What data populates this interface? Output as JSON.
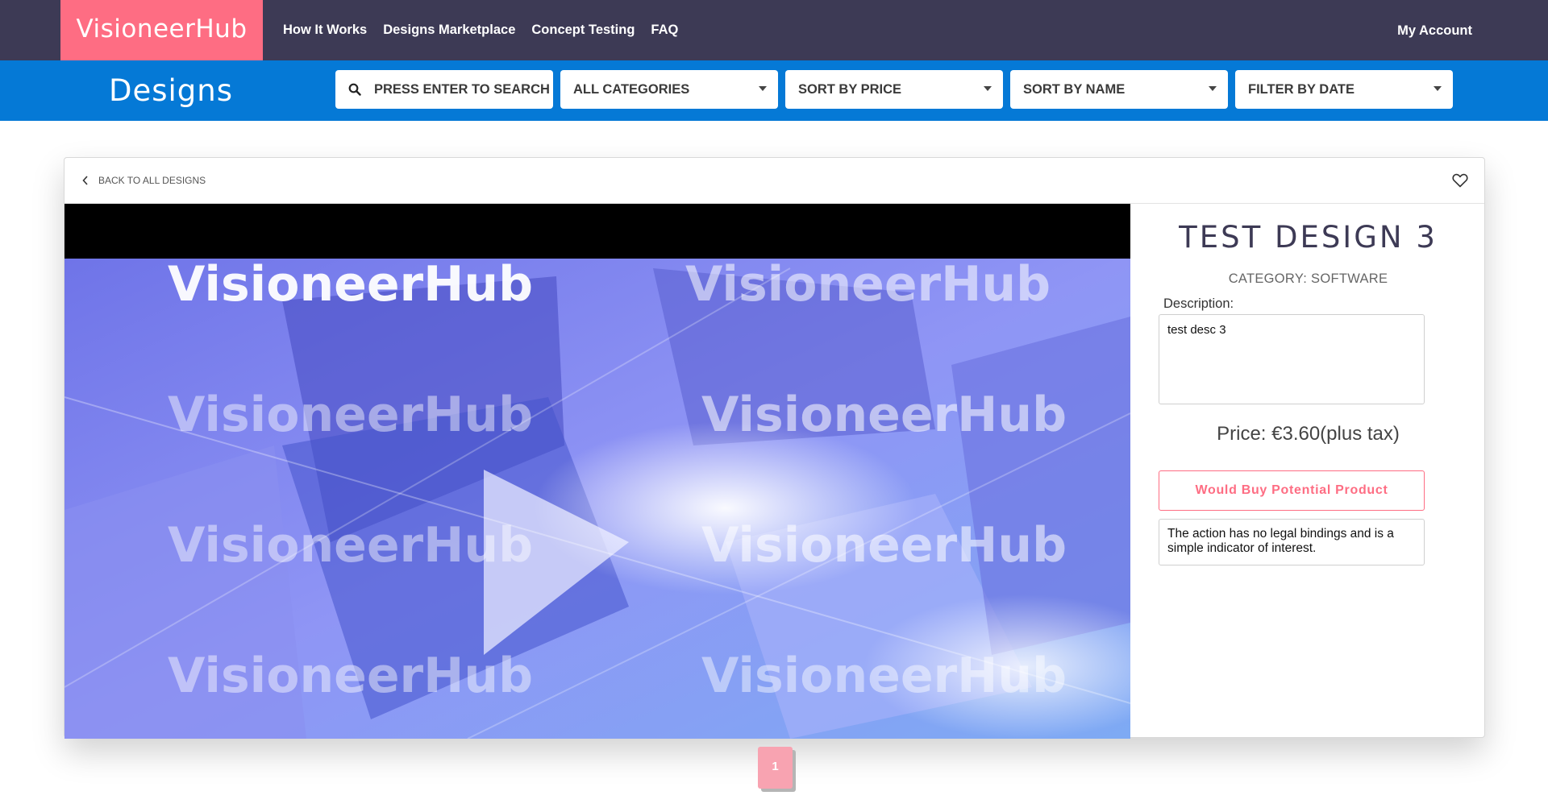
{
  "brand": {
    "name": "VisioneerHub",
    "color": "#fe6d83"
  },
  "nav": {
    "links": [
      "How It Works",
      "Designs Marketplace",
      "Concept Testing",
      "FAQ"
    ],
    "account": "My Account"
  },
  "toolbar": {
    "title": "Designs",
    "search_placeholder": "PRESS ENTER TO SEARCH",
    "categories": "ALL CATEGORIES",
    "sort_price": "SORT BY PRICE",
    "sort_name": "SORT BY NAME",
    "filter_date": "FILTER BY DATE"
  },
  "card": {
    "back_label": "BACK TO ALL DESIGNS",
    "watermark": "VisioneerHub"
  },
  "design": {
    "title": "TEST DESIGN 3",
    "category": "CATEGORY: SOFTWARE",
    "description_label": "Description:",
    "description": "test desc 3",
    "price": "Price: €3.60(plus tax)",
    "buy_label": "Would Buy Potential Product",
    "disclaimer": "The action has no legal bindings and is a simple indicator of interest."
  },
  "pagination": {
    "current": "1"
  },
  "colors": {
    "nav_bg": "#3d3a55",
    "toolbar_bg": "#0579d6",
    "accent": "#fe6d83"
  }
}
